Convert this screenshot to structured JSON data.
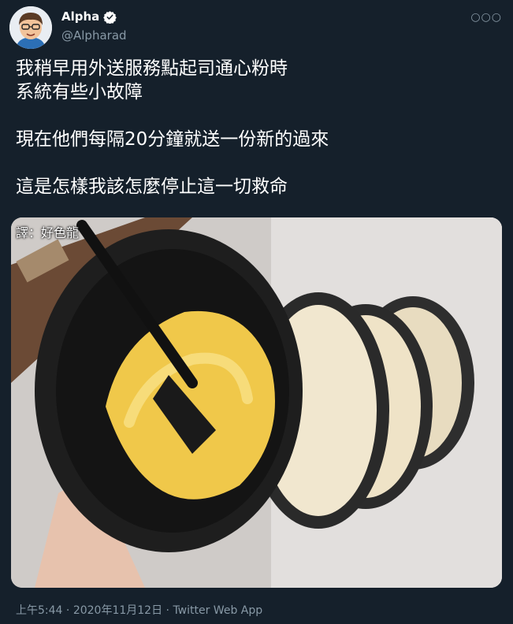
{
  "author": {
    "display_name": "Alpha",
    "handle": "@Alpharad",
    "verified": true,
    "avatar_icon": "cartoon-avatar-icon"
  },
  "tweet": {
    "paragraphs": [
      "我稍早用外送服務點起司通心粉時",
      "系統有些小故障",
      "",
      "現在他們每隔20分鐘就送一份新的過來",
      "",
      "這是怎樣我該怎麼停止這一切救命"
    ]
  },
  "media": {
    "watermark": "譯：好色龍"
  },
  "meta": {
    "time": "上午5:44",
    "separator1": " · ",
    "date": "2020年11月12日",
    "separator2": " · ",
    "app": "Twitter Web App"
  },
  "colors": {
    "background": "#15202b",
    "secondary_text": "#8899a6",
    "verified_badge": "#ffffff"
  }
}
